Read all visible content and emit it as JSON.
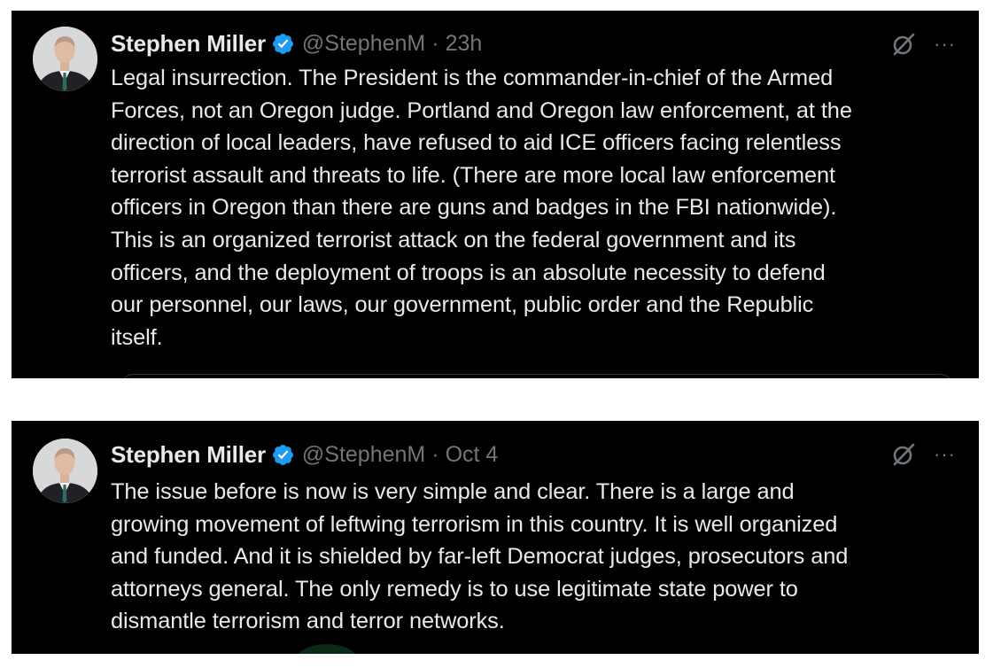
{
  "tweets": [
    {
      "author": {
        "name": "Stephen Miller",
        "handle": "@StephenM",
        "verified": true
      },
      "separator": "·",
      "time": "23h",
      "more_icon": "···",
      "text": "Legal insurrection. The President is the commander-in-chief of the Armed\nForces, not an Oregon judge. Portland and Oregon law enforcement, at the\ndirection of local leaders, have refused to aid ICE officers facing relentless\nterrorist assault and threats to life. (There are more local law enforcement\nofficers in Oregon than there are guns and badges in the FBI nationwide).\nThis is an organized terrorist attack on the federal government and its\nofficers, and the deployment of troops is an absolute necessity to defend\nour personnel, our laws, our government, public order and the Republic\nitself."
    },
    {
      "author": {
        "name": "Stephen Miller",
        "handle": "@StephenM",
        "verified": true
      },
      "separator": "·",
      "time": "Oct 4",
      "more_icon": "···",
      "text": "The issue before is now is very simple and clear. There is a large and\ngrowing movement of leftwing terrorism in this country. It is well organized\nand funded. And it is shielded by far-left Democrat judges, prosecutors and\nattorneys general. The only remedy is to use legitimate state power to\ndismantle terrorism and terror networks."
    }
  ],
  "colors": {
    "background": "#000000",
    "text": "#e7e9ea",
    "secondary": "#71767b",
    "verified_badge": "#1d9bf0"
  },
  "icons": [
    "verified-badge-icon",
    "grok-icon",
    "more-icon"
  ]
}
